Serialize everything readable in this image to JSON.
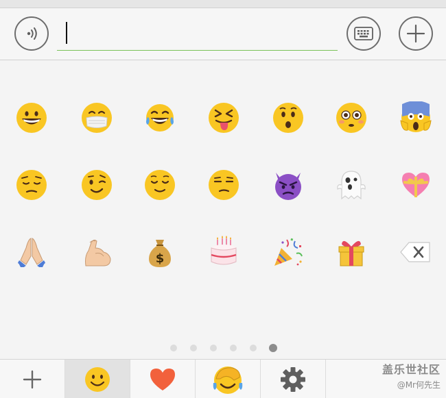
{
  "input_bar": {
    "text_value": "",
    "voice_icon": "voice-icon",
    "keyboard_icon": "keyboard-icon",
    "add_icon": "plus-icon",
    "underline_color": "#79c257"
  },
  "emoji_page": {
    "rows": [
      [
        "grinning-face",
        "face-with-medical-mask",
        "face-with-tears-of-joy",
        "squinting-face-with-tongue",
        "hushed-face",
        "flushed-face",
        "face-screaming-in-fear"
      ],
      [
        "pensive-face",
        "winking-face",
        "relieved-face",
        "unamused-face",
        "angry-face-with-horns",
        "ghost",
        "heart-with-ribbon"
      ],
      [
        "folded-hands",
        "flexed-biceps",
        "money-bag",
        "birthday-cake",
        "party-popper",
        "wrapped-gift",
        "backspace-key"
      ]
    ]
  },
  "pager": {
    "total_pages": 6,
    "current_page": 6
  },
  "tabbar": {
    "tabs": [
      {
        "icon": "add-icon",
        "selected": false
      },
      {
        "icon": "smiley-icon",
        "selected": true
      },
      {
        "icon": "heart-icon",
        "selected": false
      },
      {
        "icon": "facepalm-emoji-icon",
        "selected": false
      },
      {
        "icon": "settings-gear-icon",
        "selected": false
      }
    ]
  },
  "watermark": {
    "line1": "盖乐世社区",
    "line2": "@Mr何先生"
  },
  "colors": {
    "emoji_yellow": "#f9c623",
    "accent_green": "#79c257",
    "heart_red": "#f2613c"
  }
}
